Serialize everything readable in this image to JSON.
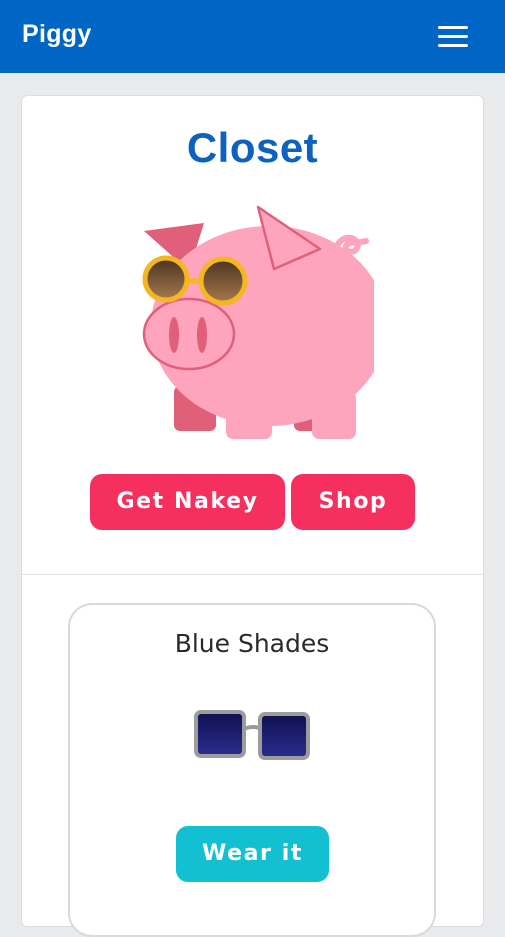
{
  "app": {
    "brand": "Piggy",
    "menu_icon": "hamburger-menu-icon"
  },
  "closet": {
    "title": "Closet",
    "pig_image": "pig-wearing-round-sunglasses",
    "buttons": {
      "get_nakey": "Get Nakey",
      "shop": "Shop"
    }
  },
  "items": [
    {
      "name": "Blue Shades",
      "image": "blue-square-sunglasses-icon",
      "action": "Wear it"
    }
  ],
  "colors": {
    "navbar": "#0066c6",
    "title": "#0d62bf",
    "primary_button": "#f5305f",
    "wear_button": "#12c0d2",
    "pig_pink": "#ffa4bd"
  }
}
